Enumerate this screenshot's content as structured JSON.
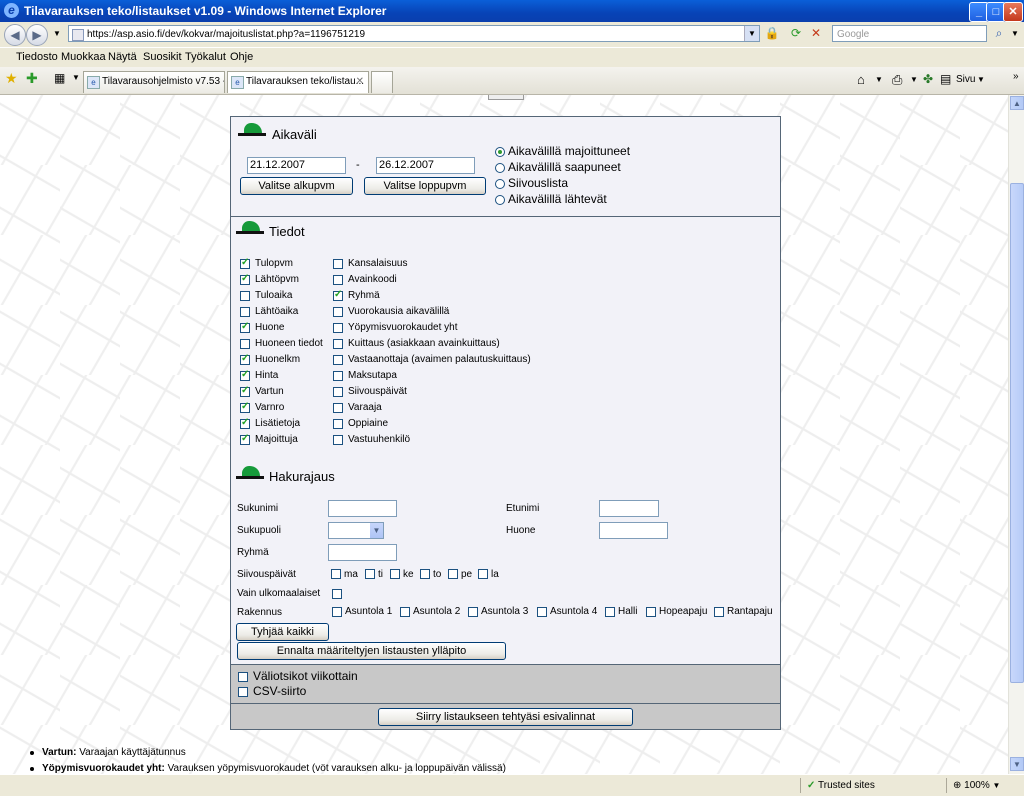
{
  "window": {
    "title": "Tilavarauksen teko/listaukset v1.09 - Windows Internet Explorer"
  },
  "address": {
    "url": "https://asp.asio.fi/dev/kokvar/majoituslistat.php?a=1196751219",
    "search_placeholder": "Google"
  },
  "menu": [
    "Tiedosto",
    "Muokkaa",
    "Näytä",
    "Suosikit",
    "Työkalut",
    "Ohje"
  ],
  "tabs": [
    {
      "label": "Tilavarausohjelmisto v7.53 - ..."
    },
    {
      "label": "Tilavarauksen teko/listau..."
    }
  ],
  "toolbar": {
    "page_label": "Sivu"
  },
  "aikavali": {
    "title": "Aikaväli",
    "start_date": "21.12.2007",
    "end_date": "26.12.2007",
    "dash": "-",
    "start_button": "Valitse alkupvm",
    "end_button": "Valitse loppupvm",
    "options": [
      {
        "label": "Aikavälillä majoittuneet",
        "selected": true
      },
      {
        "label": "Aikavälillä saapuneet",
        "selected": false
      },
      {
        "label": "Siivouslista",
        "selected": false
      },
      {
        "label": "Aikavälillä lähtevät",
        "selected": false
      }
    ]
  },
  "tiedot": {
    "title": "Tiedot",
    "col1": [
      {
        "label": "Tulopvm",
        "checked": true
      },
      {
        "label": "Lähtöpvm",
        "checked": true
      },
      {
        "label": "Tuloaika",
        "checked": false
      },
      {
        "label": "Lähtöaika",
        "checked": false
      },
      {
        "label": "Huone",
        "checked": true
      },
      {
        "label": "Huoneen tiedot",
        "checked": false
      },
      {
        "label": "Huonelkm",
        "checked": true
      },
      {
        "label": "Hinta",
        "checked": true
      },
      {
        "label": "Vartun",
        "checked": true
      },
      {
        "label": "Varnro",
        "checked": true
      },
      {
        "label": "Lisätietoja",
        "checked": true
      },
      {
        "label": "Majoittuja",
        "checked": true
      }
    ],
    "col2": [
      {
        "label": "Kansalaisuus",
        "checked": false
      },
      {
        "label": "Avainkoodi",
        "checked": false
      },
      {
        "label": "Ryhmä",
        "checked": true
      },
      {
        "label": "Vuorokausia aikavälillä",
        "checked": false
      },
      {
        "label": "Yöpymisvuorokaudet yht",
        "checked": false
      },
      {
        "label": "Kuittaus (asiakkaan avainkuittaus)",
        "checked": false
      },
      {
        "label": "Vastaanottaja (avaimen palautuskuittaus)",
        "checked": false
      },
      {
        "label": "Maksutapa",
        "checked": false
      },
      {
        "label": "Siivouspäivät",
        "checked": false
      },
      {
        "label": "Varaaja",
        "checked": false
      },
      {
        "label": "Oppiaine",
        "checked": false
      },
      {
        "label": "Vastuuhenkilö",
        "checked": false
      }
    ]
  },
  "hakurajaus": {
    "title": "Hakurajaus",
    "sukunimi": "Sukunimi",
    "etunimi": "Etunimi",
    "sukupuoli": "Sukupuoli",
    "huone": "Huone",
    "ryhma": "Ryhmä",
    "siivouspaivat": "Siivouspäivät",
    "days": [
      "ma",
      "ti",
      "ke",
      "to",
      "pe",
      "la"
    ],
    "vain_ulkomaalaiset": "Vain ulkomaalaiset",
    "rakennus": "Rakennus",
    "buildings": [
      "Asuntola 1",
      "Asuntola 2",
      "Asuntola 3",
      "Asuntola 4",
      "Halli",
      "Hopeapaju",
      "Rantapaju"
    ],
    "clear_button": "Tyhjää kaikki",
    "predefined_button": "Ennalta määriteltyjen listausten ylläpito"
  },
  "options": {
    "valiotsikot": "Väliotsikot viikottain",
    "csv": "CSV-siirto"
  },
  "submit_button": "Siirry listaukseen tehtyäsi esivalinnat",
  "notes": [
    {
      "term": "Vartun:",
      "text": " Varaajan käyttäjätunnus"
    },
    {
      "term": "Yöpymisvuorokaudet yht:",
      "text": " Varauksen yöpymisvuorokaudet (vöt varauksen alku- ja loppupäivän välissä)"
    }
  ],
  "status": {
    "zone": "Trusted sites",
    "zoom": "100%"
  }
}
